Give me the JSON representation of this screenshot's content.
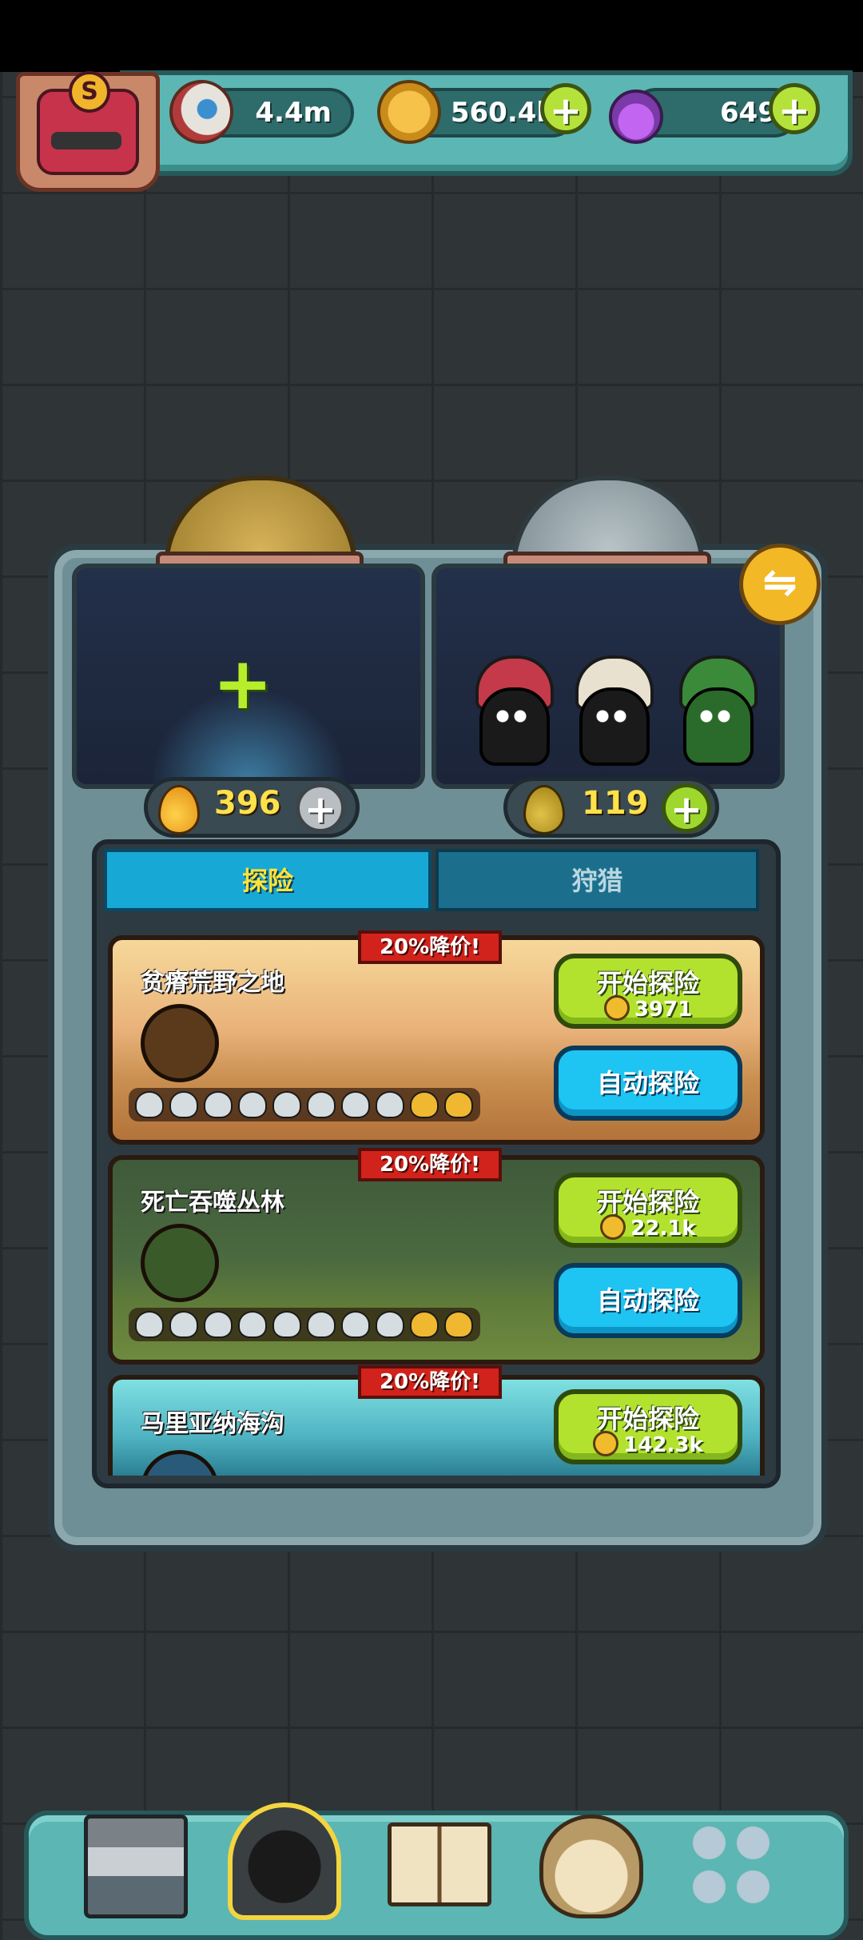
{
  "resources": {
    "eyeballs": "4.4m",
    "coins": "560.4k",
    "potions": "649"
  },
  "badge": {
    "rank_letter": "S"
  },
  "drops": {
    "left": "396",
    "right": "119"
  },
  "tabs": [
    {
      "label": "探险",
      "active": true
    },
    {
      "label": "狩猎",
      "active": false
    }
  ],
  "expeditions": [
    {
      "name": "贫瘠荒野之地",
      "discount": "20%降价!",
      "start_label": "开始探险",
      "cost": "3971",
      "auto_label": "自动探险"
    },
    {
      "name": "死亡吞噬丛林",
      "discount": "20%降价!",
      "start_label": "开始探险",
      "cost": "22.1k",
      "auto_label": "自动探险"
    },
    {
      "name": "马里亚纳海沟",
      "discount": "20%降价!",
      "start_label": "开始探险",
      "cost": "142.3k"
    }
  ],
  "icons": {
    "add": "+",
    "swap": "⇋"
  },
  "colors": {
    "accent_green": "#b2e22e",
    "accent_blue": "#1ec4f2",
    "discount_red": "#d1231b",
    "header_teal": "#5cb6b3"
  }
}
